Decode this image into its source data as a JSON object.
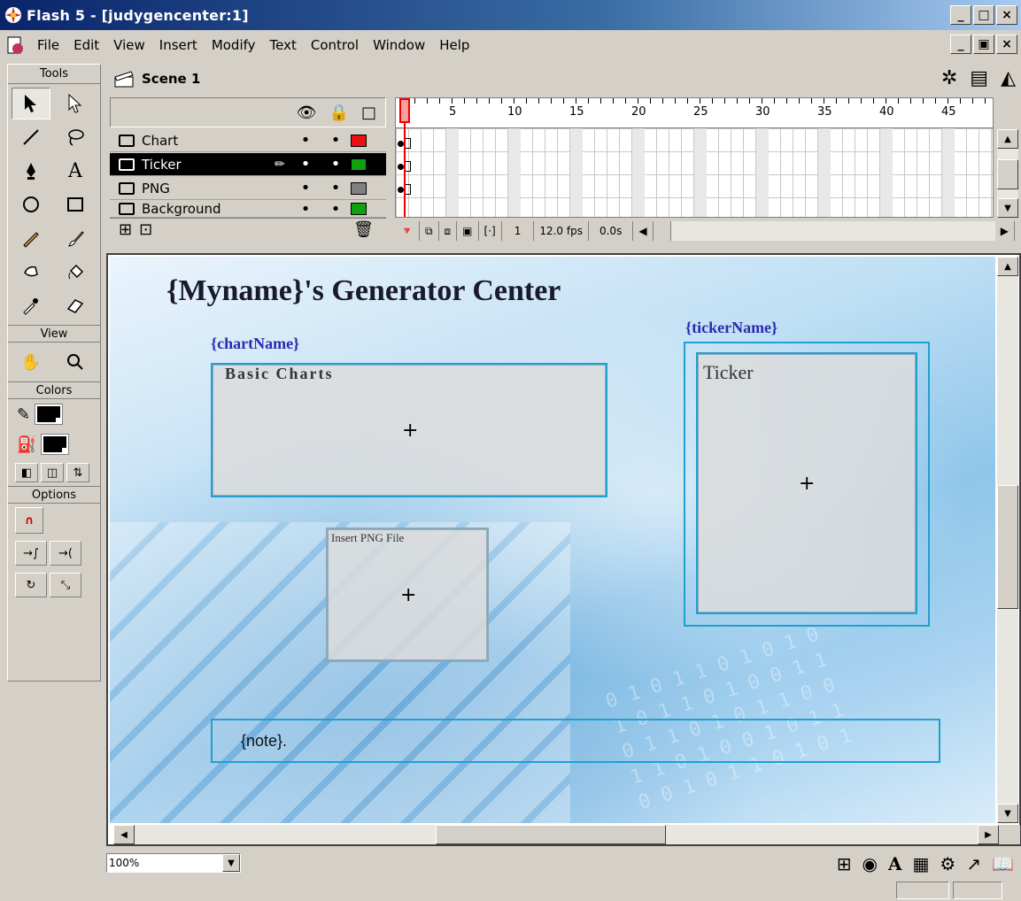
{
  "window": {
    "title": "Flash 5 - [judygencenter:1]",
    "controls": {
      "minimize": "_",
      "maximize": "□",
      "close": "×",
      "restore": "▣"
    }
  },
  "menu": [
    "File",
    "Edit",
    "View",
    "Insert",
    "Modify",
    "Text",
    "Control",
    "Window",
    "Help"
  ],
  "tools": {
    "header": "Tools",
    "view_header": "View",
    "colors_header": "Colors",
    "options_header": "Options",
    "icons": [
      "arrow-tool",
      "subselect-tool",
      "line-tool",
      "lasso-tool",
      "pen-tool",
      "text-tool",
      "oval-tool",
      "rectangle-tool",
      "pencil-tool",
      "brush-tool",
      "ink-bottle-tool",
      "paint-bucket-tool",
      "dropper-tool",
      "eraser-tool"
    ]
  },
  "scene": {
    "label": "Scene 1"
  },
  "timeline": {
    "layers": [
      {
        "name": "Chart",
        "color": "#e81010",
        "selected": false
      },
      {
        "name": "Ticker",
        "color": "#10a010",
        "selected": true
      },
      {
        "name": "PNG",
        "color": "#808080",
        "selected": false
      },
      {
        "name": "Background",
        "color": "#10a010",
        "selected": false
      }
    ],
    "ruler_numbers": [
      "1",
      "5",
      "10",
      "15",
      "20",
      "25",
      "30",
      "35",
      "40",
      "45"
    ],
    "current_frame": "1",
    "frame_rate": "12.0 fps",
    "elapsed": "0.0s"
  },
  "stage": {
    "heading": "{Myname}'s Generator Center",
    "chart_label": "{chartName}",
    "chart_box_title": "Basic Charts",
    "ticker_label": "{tickerName}",
    "ticker_box_title": "Ticker",
    "png_box_title": "Insert PNG File",
    "note_text": "{note}.",
    "registration_mark": "+"
  },
  "bottom": {
    "zoom": "100%"
  }
}
